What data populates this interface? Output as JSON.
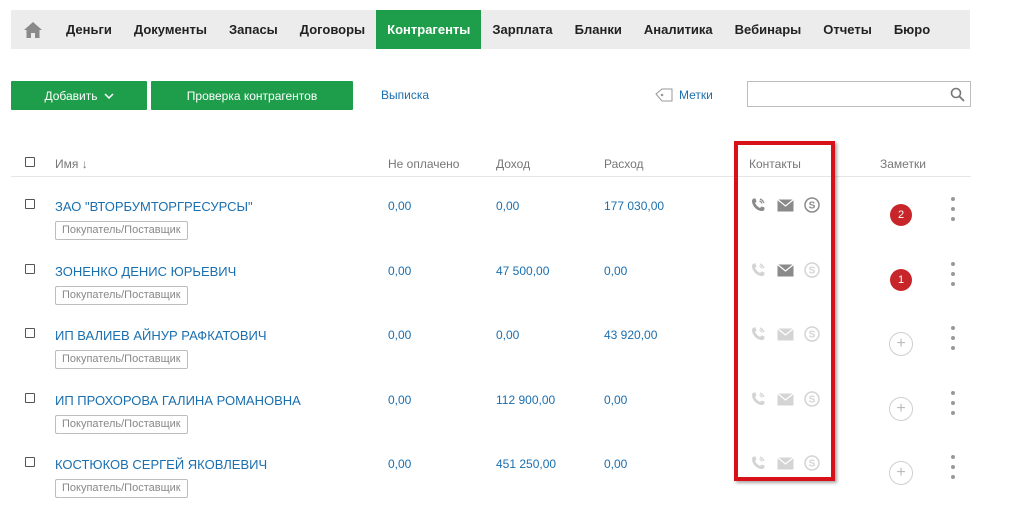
{
  "nav": {
    "items": [
      {
        "label": "Деньги"
      },
      {
        "label": "Документы"
      },
      {
        "label": "Запасы"
      },
      {
        "label": "Договоры"
      },
      {
        "label": "Контрагенты",
        "active": true
      },
      {
        "label": "Зарплата"
      },
      {
        "label": "Бланки"
      },
      {
        "label": "Аналитика"
      },
      {
        "label": "Вебинары"
      },
      {
        "label": "Отчеты"
      },
      {
        "label": "Бюро"
      }
    ]
  },
  "toolbar": {
    "add_label": "Добавить",
    "check_label": "Проверка контрагентов",
    "vypiska_label": "Выписка",
    "metki_label": "Метки",
    "search_placeholder": ""
  },
  "table": {
    "headers": {
      "name": "Имя ↓",
      "unpaid": "Не оплачено",
      "income": "Доход",
      "expense": "Расход",
      "contacts": "Контакты",
      "notes": "Заметки"
    },
    "rows": [
      {
        "name": "ЗАО \"ВТОРБУМТОРГРЕСУРСЫ\"",
        "tag": "Покупатель/Поставщик",
        "unpaid": "0,00",
        "income": "0,00",
        "expense": "177 030,00",
        "contacts_active": true,
        "note_count": "2"
      },
      {
        "name": "ЗОНЕНКО ДЕНИС ЮРЬЕВИЧ",
        "tag": "Покупатель/Поставщик",
        "unpaid": "0,00",
        "income": "47 500,00",
        "expense": "0,00",
        "contacts_active": false,
        "email_active": true,
        "note_count": "1"
      },
      {
        "name": "ИП ВАЛИЕВ АЙНУР РАФКАТОВИЧ",
        "tag": "Покупатель/Поставщик",
        "unpaid": "0,00",
        "income": "0,00",
        "expense": "43 920,00",
        "contacts_active": false,
        "note_count": ""
      },
      {
        "name": "ИП ПРОХОРОВА ГАЛИНА РОМАНОВНА",
        "tag": "Покупатель/Поставщик",
        "unpaid": "0,00",
        "income": "112 900,00",
        "expense": "0,00",
        "contacts_active": false,
        "note_count": ""
      },
      {
        "name": "КОСТЮКОВ СЕРГЕЙ ЯКОВЛЕВИЧ",
        "tag": "Покупатель/Поставщик",
        "unpaid": "0,00",
        "income": "451 250,00",
        "expense": "0,00",
        "contacts_active": false,
        "note_count": ""
      }
    ]
  },
  "colors": {
    "accent": "#1e9e4b",
    "link": "#1a6faf",
    "badge": "#c8252a",
    "highlight": "#d8101a"
  }
}
